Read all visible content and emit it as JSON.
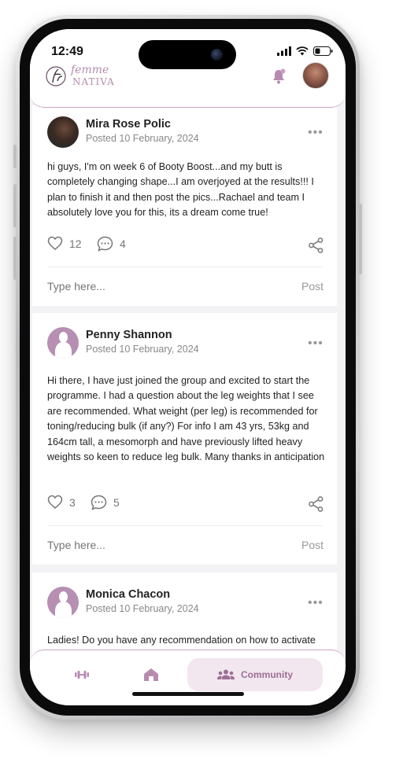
{
  "status": {
    "time": "12:49"
  },
  "brand": {
    "line1": "femme",
    "line2": "NATIVA",
    "accent": "#b78bb0"
  },
  "header": {
    "bell_icon": "bell-icon",
    "avatar": "profile-avatar"
  },
  "posts": [
    {
      "author": "Mira Rose Polic",
      "date": "Posted 10 February, 2024",
      "text": "hi guys, I'm on week 6 of Booty Boost...and my butt is completely changing shape...I am overjoyed at the results!!! I plan to finish it and then post the pics...Rachael and team I absolutely love you for this, its a dream come true!",
      "likes": "12",
      "comments": "4",
      "input_placeholder": "Type here...",
      "post_label": "Post"
    },
    {
      "author": "Penny  Shannon",
      "date": "Posted 10 February, 2024",
      "text": "Hi there, I have just joined the group and excited to start the programme. I had a question about the leg weights that I see are recommended. What weight (per leg) is recommended for toning/reducing bulk (if any?) For info I am 43 yrs, 53kg and 164cm tall, a mesomorph and have previously lifted heavy weights so keen to reduce leg bulk. Many thanks in anticipation",
      "likes": "3",
      "comments": "5",
      "input_placeholder": "Type here...",
      "post_label": "Post"
    },
    {
      "author": "Monica Chacon",
      "date": "Posted 10 February, 2024",
      "text": "Ladies! Do you have any recommendation on how to activate"
    }
  ],
  "nav": {
    "items": [
      "dumbbell-icon",
      "home-icon"
    ],
    "active_label": "Community",
    "active_icon": "community-icon"
  }
}
